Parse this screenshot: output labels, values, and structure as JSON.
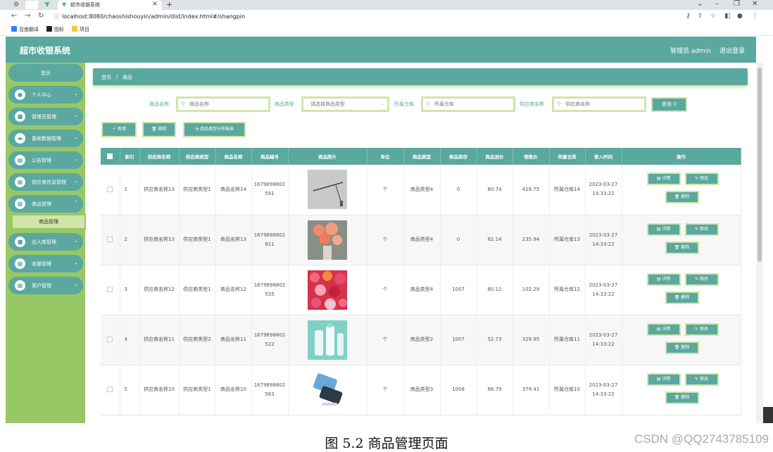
{
  "browser": {
    "tab_title": "超市收银系统",
    "url": "localhost:8080/chaoshishouyin/admin/dist/index.html#/shangpin",
    "bookmarks": [
      "百度翻译",
      "图标",
      "项目"
    ]
  },
  "header": {
    "app_title": "超市收银系统",
    "admin": "管理员 admin",
    "logout": "退出登录"
  },
  "sidebar": {
    "home": "首页",
    "items": [
      {
        "label": "个人中心",
        "icon": "user-icon"
      },
      {
        "label": "管理员管理",
        "icon": "briefcase-icon"
      },
      {
        "label": "基础数据管理",
        "icon": "database-icon"
      },
      {
        "label": "公告管理",
        "icon": "grid-icon"
      },
      {
        "label": "供应商信息管理",
        "icon": "grid-icon"
      },
      {
        "label": "商品管理",
        "icon": "grid-icon"
      },
      {
        "label": "出入库管理",
        "icon": "box-icon"
      },
      {
        "label": "收银管理",
        "icon": "grid-icon"
      },
      {
        "label": "客户管理",
        "icon": "grid-icon"
      }
    ],
    "active_sub": "商品管理"
  },
  "breadcrumb": {
    "home": "首页",
    "sep": "/",
    "current": "商品"
  },
  "filters": {
    "name_label": "商品名称",
    "name_placeholder": "商品名称",
    "type_label": "商品类型",
    "type_placeholder": "请选择商品类型",
    "warehouse_label": "所属仓库",
    "warehouse_placeholder": "所属仓库",
    "supplier_label": "供应商名称",
    "supplier_placeholder": "供应商名称",
    "query_button": "查询"
  },
  "actions": {
    "add": "新增",
    "delete": "删除",
    "chart": "商品类型分布报表"
  },
  "table": {
    "headers": [
      "索引",
      "供应商名称",
      "供应商类型",
      "商品名称",
      "商品编号",
      "商品照片",
      "单位",
      "商品类型",
      "商品库存",
      "商品进价",
      "销售价",
      "所属仓库",
      "录入时间",
      "操作"
    ],
    "op_detail": "详情",
    "op_edit": "修改",
    "op_delete": "删除",
    "rows": [
      {
        "index": "1",
        "supplier": "供应商名称13",
        "supplier_type": "供应商类型1",
        "name": "商品名称14",
        "code": "1679898802591",
        "photo": "branch-photo",
        "unit": "个",
        "type": "商品类型4",
        "stock": "0",
        "cost": "80.74",
        "price": "418.75",
        "warehouse": "所属仓库14",
        "time": "2023-03-27 14:33:22"
      },
      {
        "index": "2",
        "supplier": "供应商名称13",
        "supplier_type": "供应商类型1",
        "name": "商品名称13",
        "code": "1679898802611",
        "photo": "flowers-photo",
        "unit": "个",
        "type": "商品类型4",
        "stock": "0",
        "cost": "82.14",
        "price": "235.94",
        "warehouse": "所属仓库13",
        "time": "2023-03-27 14:33:22"
      },
      {
        "index": "3",
        "supplier": "供应商名称12",
        "supplier_type": "供应商类型1",
        "name": "商品名称12",
        "code": "1679898802535",
        "photo": "roses-photo",
        "unit": "个",
        "type": "商品类型4",
        "stock": "1007",
        "cost": "80.12",
        "price": "102.29",
        "warehouse": "所属仓库12",
        "time": "2023-03-27 14:33:22"
      },
      {
        "index": "4",
        "supplier": "供应商名称11",
        "supplier_type": "供应商类型2",
        "name": "商品名称11",
        "code": "1679898802522",
        "photo": "bottles-photo",
        "unit": "个",
        "type": "商品类型2",
        "stock": "1007",
        "cost": "52.73",
        "price": "329.95",
        "warehouse": "所属仓库11",
        "time": "2023-03-27 14:33:22"
      },
      {
        "index": "5",
        "supplier": "供应商名称10",
        "supplier_type": "供应商类型1",
        "name": "商品名称10",
        "code": "1679898802563",
        "photo": "phone-photo",
        "unit": "个",
        "type": "商品类型3",
        "stock": "1008",
        "cost": "66.79",
        "price": "379.41",
        "warehouse": "所属仓库10",
        "time": "2023-03-27 14:33:22"
      }
    ]
  },
  "caption": "图 5.2    商品管理页面",
  "watermark": "CSDN @QQ2743785109",
  "colors": {
    "primary": "#5aa89f",
    "sidebar": "#98c765",
    "accent_border": "#cfe6a8"
  }
}
